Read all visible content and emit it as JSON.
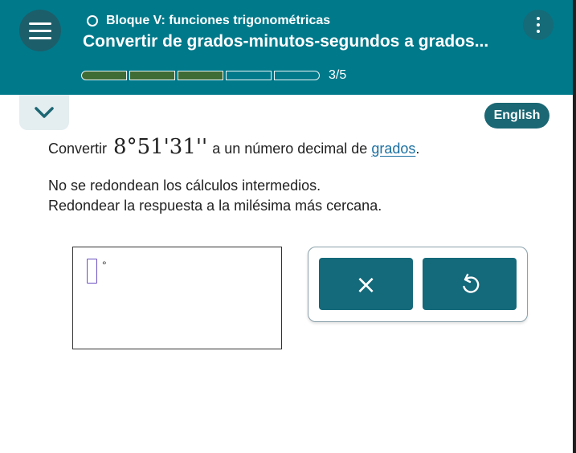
{
  "header": {
    "topic": "Bloque V: funciones trigonométricas",
    "title": "Convertir de grados-minutos-segundos a grados...",
    "progress": {
      "completed": 3,
      "total": 5,
      "label": "3/5"
    }
  },
  "language_button": "English",
  "question": {
    "prefix": "Convertir",
    "expression": "8°51'31''",
    "middle": "a un número decimal de",
    "link": "grados",
    "suffix": ".",
    "note1": "No se redondean los cálculos intermedios.",
    "note2": "Redondear la respuesta a la milésima más cercana."
  },
  "answer": {
    "value": "",
    "unit": "°"
  },
  "tools": {
    "clear_icon": "×",
    "undo_icon": "undo-icon"
  },
  "colors": {
    "header_bg": "#00798a",
    "button_bg": "#14697a",
    "progress_fill": "#3f6b34"
  }
}
